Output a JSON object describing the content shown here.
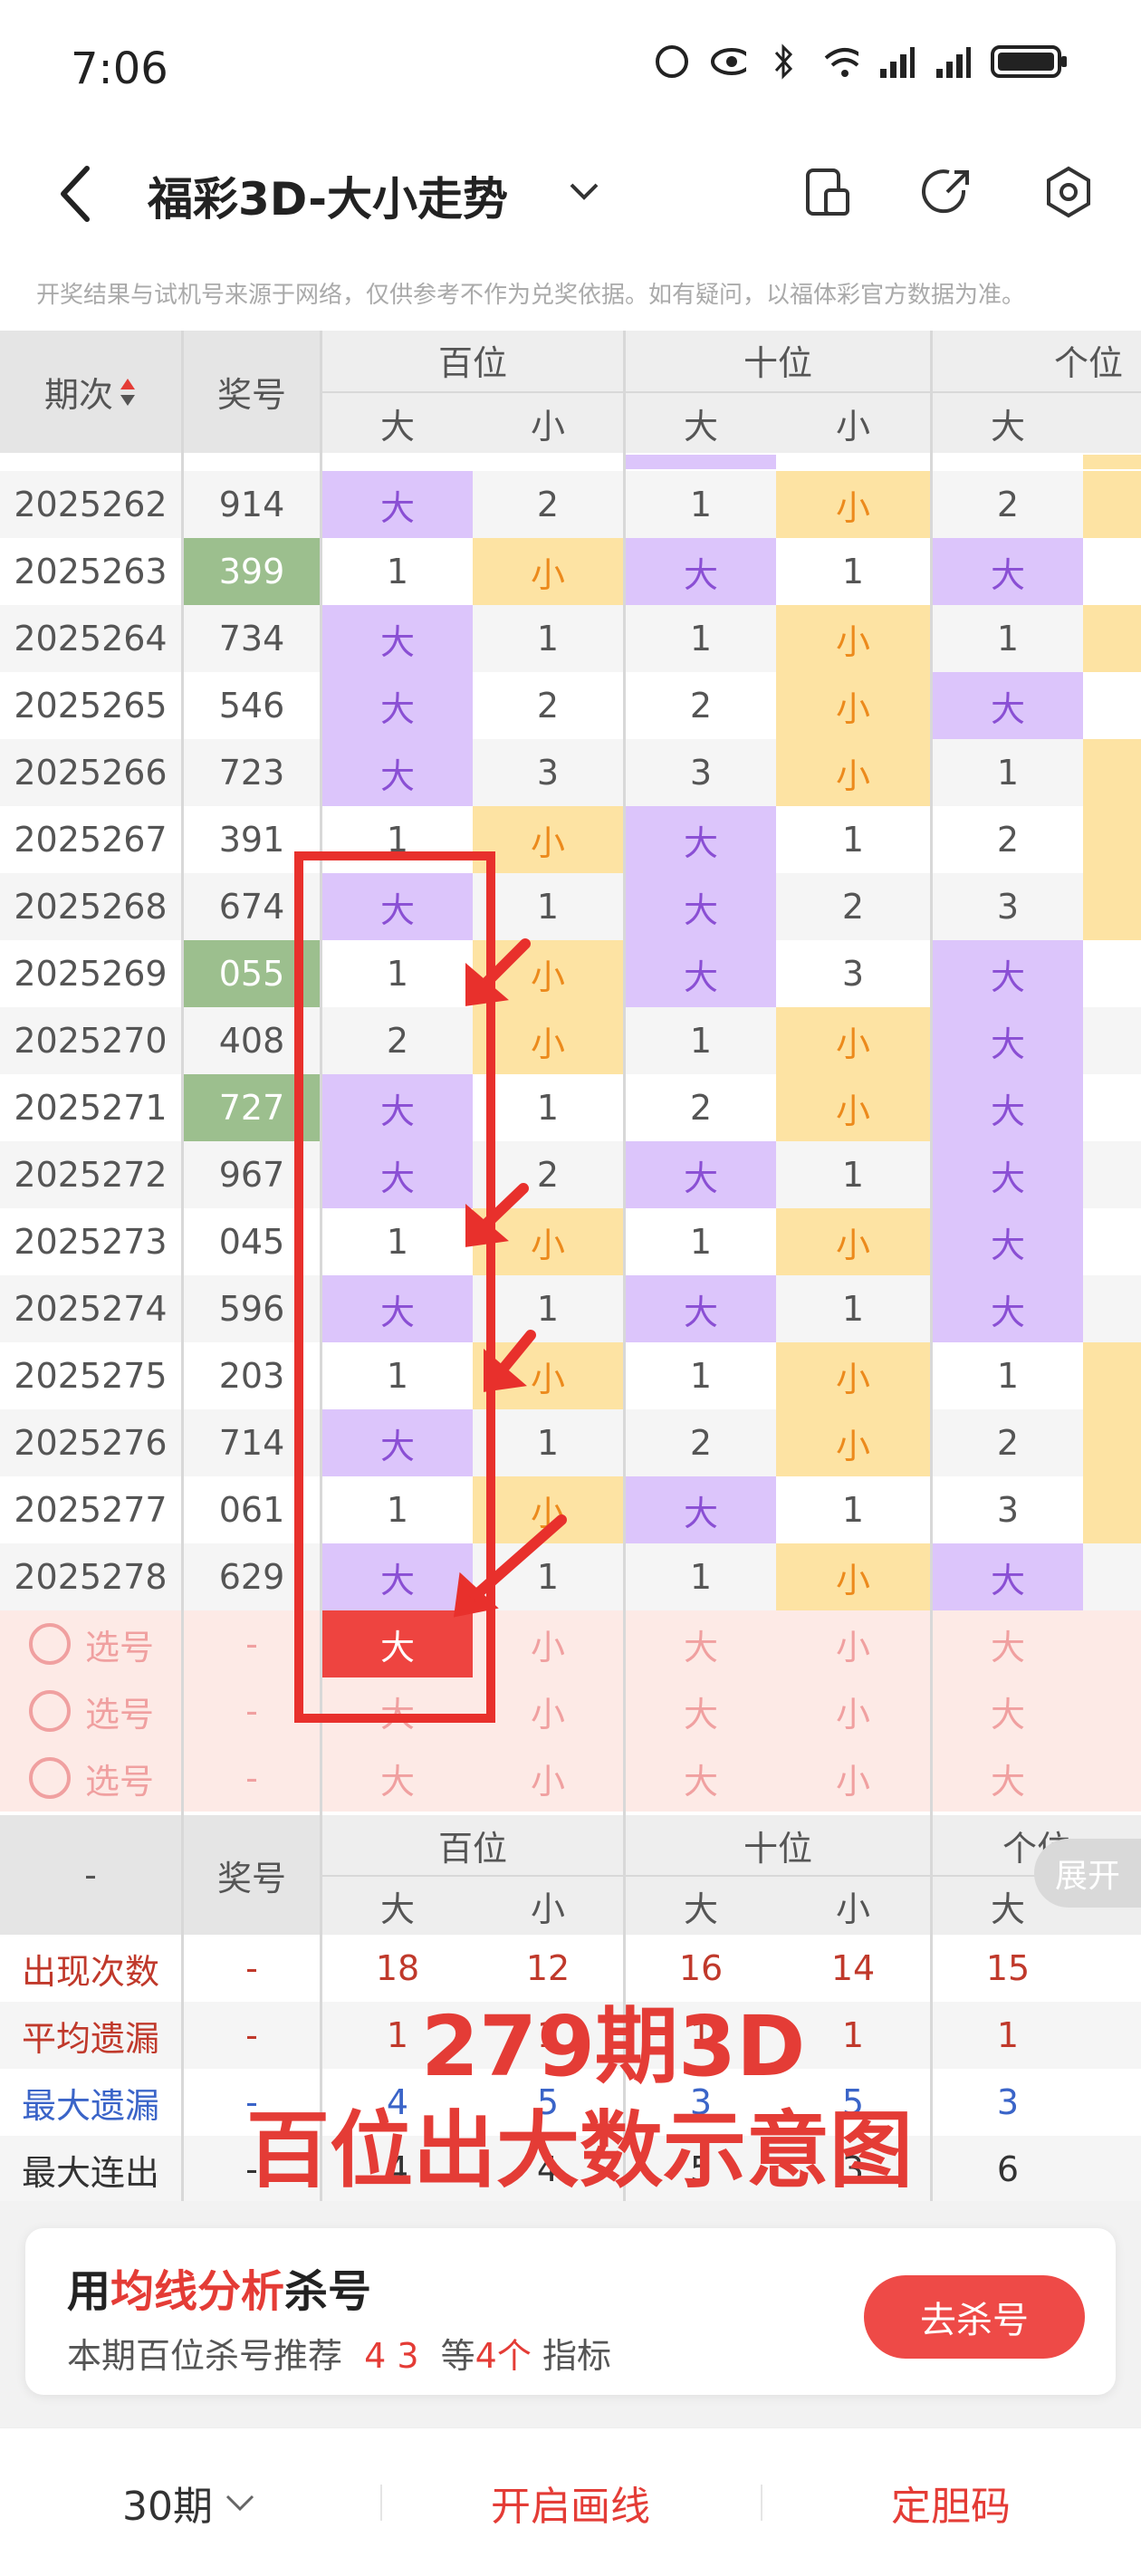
{
  "status": {
    "time": "7:06"
  },
  "header": {
    "title": "福彩3D-大小走势"
  },
  "disclaimer": "开奖结果与试机号来源于网络，仅供参考不作为兑奖依据。如有疑问，以福体彩官方数据为准。",
  "table_header": {
    "period": "期次",
    "award": "奖号",
    "hundreds": "百位",
    "tens": "十位",
    "units": "个位",
    "big": "大",
    "small": "小"
  },
  "rows": [
    {
      "period": "2025262",
      "award": "914",
      "green": false,
      "cells": [
        "大",
        "2",
        "1",
        "小",
        "2",
        ""
      ]
    },
    {
      "period": "2025263",
      "award": "399",
      "green": true,
      "cells": [
        "1",
        "小",
        "大",
        "1",
        "大",
        ""
      ]
    },
    {
      "period": "2025264",
      "award": "734",
      "green": false,
      "cells": [
        "大",
        "1",
        "1",
        "小",
        "1",
        ""
      ]
    },
    {
      "period": "2025265",
      "award": "546",
      "green": false,
      "cells": [
        "大",
        "2",
        "2",
        "小",
        "大",
        ""
      ]
    },
    {
      "period": "2025266",
      "award": "723",
      "green": false,
      "cells": [
        "大",
        "3",
        "3",
        "小",
        "1",
        ""
      ]
    },
    {
      "period": "2025267",
      "award": "391",
      "green": false,
      "cells": [
        "1",
        "小",
        "大",
        "1",
        "2",
        ""
      ]
    },
    {
      "period": "2025268",
      "award": "674",
      "green": false,
      "cells": [
        "大",
        "1",
        "大",
        "2",
        "3",
        ""
      ]
    },
    {
      "period": "2025269",
      "award": "055",
      "green": true,
      "cells": [
        "1",
        "小",
        "大",
        "3",
        "大",
        ""
      ]
    },
    {
      "period": "2025270",
      "award": "408",
      "green": false,
      "cells": [
        "2",
        "小",
        "1",
        "小",
        "大",
        ""
      ]
    },
    {
      "period": "2025271",
      "award": "727",
      "green": true,
      "cells": [
        "大",
        "1",
        "2",
        "小",
        "大",
        ""
      ]
    },
    {
      "period": "2025272",
      "award": "967",
      "green": false,
      "cells": [
        "大",
        "2",
        "大",
        "1",
        "大",
        ""
      ]
    },
    {
      "period": "2025273",
      "award": "045",
      "green": false,
      "cells": [
        "1",
        "小",
        "1",
        "小",
        "大",
        ""
      ]
    },
    {
      "period": "2025274",
      "award": "596",
      "green": false,
      "cells": [
        "大",
        "1",
        "大",
        "1",
        "大",
        ""
      ]
    },
    {
      "period": "2025275",
      "award": "203",
      "green": false,
      "cells": [
        "1",
        "小",
        "1",
        "小",
        "1",
        ""
      ]
    },
    {
      "period": "2025276",
      "award": "714",
      "green": false,
      "cells": [
        "大",
        "1",
        "2",
        "小",
        "2",
        ""
      ]
    },
    {
      "period": "2025277",
      "award": "061",
      "green": false,
      "cells": [
        "1",
        "小",
        "大",
        "1",
        "3",
        ""
      ]
    },
    {
      "period": "2025278",
      "award": "629",
      "green": false,
      "cells": [
        "大",
        "1",
        "1",
        "小",
        "大",
        ""
      ]
    }
  ],
  "pick_rows": [
    {
      "label": "选号",
      "dash": "-",
      "cells": [
        "大",
        "小",
        "大",
        "小",
        "大"
      ]
    },
    {
      "label": "选号",
      "dash": "-",
      "cells": [
        "大",
        "小",
        "大",
        "小",
        "大"
      ]
    },
    {
      "label": "选号",
      "dash": "-",
      "cells": [
        "大",
        "小",
        "大",
        "小",
        "大"
      ]
    }
  ],
  "stats_header": {
    "dash": "-",
    "award": "奖号",
    "hundreds": "百位",
    "tens": "十位",
    "units": "个位",
    "expand": "展开"
  },
  "stats": [
    {
      "label": "出现次数",
      "color": "#c0392b",
      "dash": "-",
      "values": [
        "18",
        "12",
        "16",
        "14",
        "15"
      ]
    },
    {
      "label": "平均遗漏",
      "color": "#c0392b",
      "dash": "-",
      "values": [
        "1",
        "1",
        "1",
        "1",
        "1"
      ]
    },
    {
      "label": "最大遗漏",
      "color": "#3a64c8",
      "dash": "-",
      "values": [
        "4",
        "5",
        "3",
        "5",
        "3"
      ]
    },
    {
      "label": "最大连出",
      "color": "#333333",
      "dash": "-",
      "values": [
        "4",
        "4",
        "5",
        "3",
        "6"
      ]
    }
  ],
  "overlay": {
    "line1": "279期3D",
    "line2": "百位出大数示意图"
  },
  "card": {
    "title_pre": "用",
    "title_hl": "均线分析",
    "title_post": "杀号",
    "sub_pre": "本期百位杀号推荐",
    "sub_nums": "4 3",
    "sub_mid": "等",
    "sub_count": "4个",
    "sub_post": "指标",
    "button": "去杀号"
  },
  "bottom": {
    "periods": "30期",
    "draw_line": "开启画线",
    "dan": "定胆码"
  },
  "colors": {
    "purple": "#dcc5fb",
    "yellow": "#fde3a3",
    "red": "#e43c36",
    "green": "#9cbf8e"
  }
}
